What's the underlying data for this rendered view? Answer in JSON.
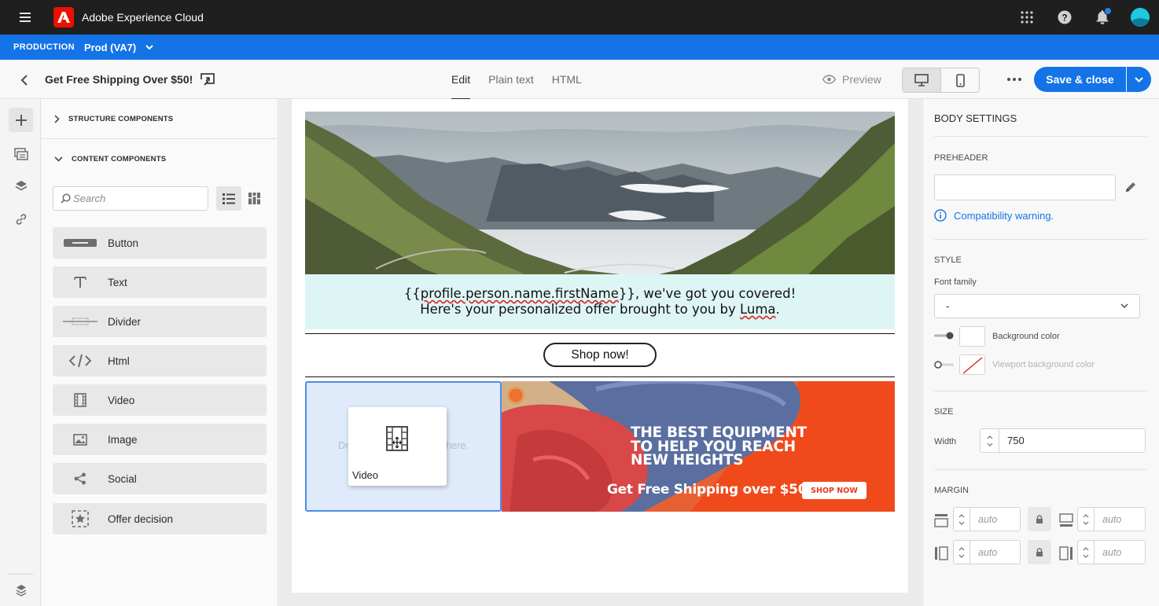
{
  "topbar": {
    "app_name": "Adobe Experience Cloud",
    "icons": [
      "menu-icon",
      "adobe-logo",
      "apps-grid-icon",
      "help-icon",
      "bell-icon",
      "avatar"
    ]
  },
  "envbar": {
    "environment": "PRODUCTION",
    "sandbox": "Prod (VA7)"
  },
  "header": {
    "title": "Get Free Shipping Over $50!",
    "tabs": [
      {
        "label": "Edit",
        "active": true
      },
      {
        "label": "Plain text",
        "active": false
      },
      {
        "label": "HTML",
        "active": false
      }
    ],
    "preview_label": "Preview",
    "save_label": "Save & close"
  },
  "components": {
    "structure_title": "STRUCTURE COMPONENTS",
    "content_title": "CONTENT COMPONENTS",
    "search_placeholder": "Search",
    "items": [
      {
        "label": "Button",
        "icon": "button-icon"
      },
      {
        "label": "Text",
        "icon": "text-icon"
      },
      {
        "label": "Divider",
        "icon": "divider-icon"
      },
      {
        "label": "Html",
        "icon": "html-icon"
      },
      {
        "label": "Video",
        "icon": "video-icon"
      },
      {
        "label": "Image",
        "icon": "image-icon"
      },
      {
        "label": "Social",
        "icon": "social-icon"
      },
      {
        "label": "Offer decision",
        "icon": "offer-decision-icon"
      }
    ]
  },
  "canvas": {
    "personalized_line1_pre": "{{",
    "personalized_line1_token": "profile.person.name.firstName",
    "personalized_line1_post": "}}, we've got you covered!",
    "personalized_line2_pre": "Here's your personalized offer brought to you by ",
    "personalized_line2_brand": "Luma",
    "personalized_line2_post": ".",
    "shop_button": "Shop now!",
    "drop_hint_left": "Dr",
    "drop_hint_right": "here.",
    "drag_label": "Video",
    "banner_headline_1": "THE BEST EQUIPMENT",
    "banner_headline_2": "TO HELP YOU REACH",
    "banner_headline_3": "NEW HEIGHTS",
    "banner_footer": "Get Free Shipping over $50",
    "banner_button": "SHOP NOW"
  },
  "body_settings": {
    "title": "BODY SETTINGS",
    "preheader_label": "PREHEADER",
    "preheader_value": "",
    "compat_warning": "Compatibility warning.",
    "style_label": "STYLE",
    "font_family_label": "Font family",
    "font_family_value": "-",
    "bg_color_label": "Background color",
    "viewport_bg_label": "Viewport background color",
    "size_label": "SIZE",
    "width_label": "Width",
    "width_value": "750",
    "margin_label": "MARGIN",
    "margin_top": "auto",
    "margin_bottom": "auto",
    "margin_left": "auto",
    "margin_right": "auto"
  },
  "colors": {
    "accent": "#1473e6",
    "topbar": "#1f1f1f",
    "teal_band": "#def5f5",
    "dropzone": "#dfeafa",
    "banner_orange": "#f04a1c"
  }
}
